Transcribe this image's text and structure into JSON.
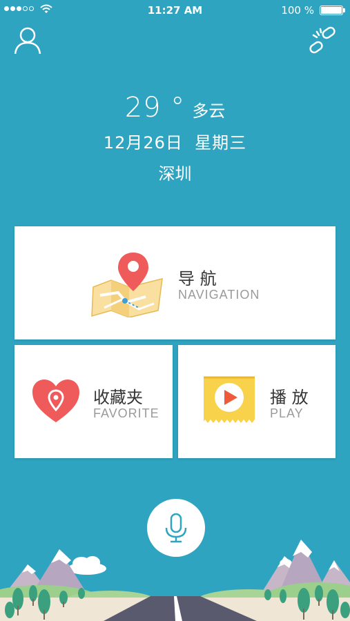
{
  "status_bar": {
    "time": "11:27 AM",
    "battery": "100 %",
    "signal_bars_filled": 3,
    "signal_bars_total": 5
  },
  "header": {
    "left_icon": "user-icon",
    "right_icon": "link-icon"
  },
  "weather": {
    "temperature": "29 °",
    "condition": "多云",
    "date": "12月26日  星期三",
    "city": "深圳"
  },
  "cards": {
    "navigation": {
      "title": "导 航",
      "subtitle": "NAVIGATION",
      "icon": "map-pin-icon"
    },
    "favorite": {
      "title": "收藏夹",
      "subtitle": "FAVORITE",
      "icon": "heart-pin-icon"
    },
    "play": {
      "title": "播 放",
      "subtitle": "PLAY",
      "icon": "play-ticket-icon"
    }
  },
  "mic": {
    "icon": "microphone-icon"
  },
  "colors": {
    "background": "#2ea4c0",
    "card": "#ffffff",
    "pin_red": "#ef5a5a",
    "ticket_yellow": "#f7d24a",
    "mic_teal": "#2ea4c0"
  }
}
